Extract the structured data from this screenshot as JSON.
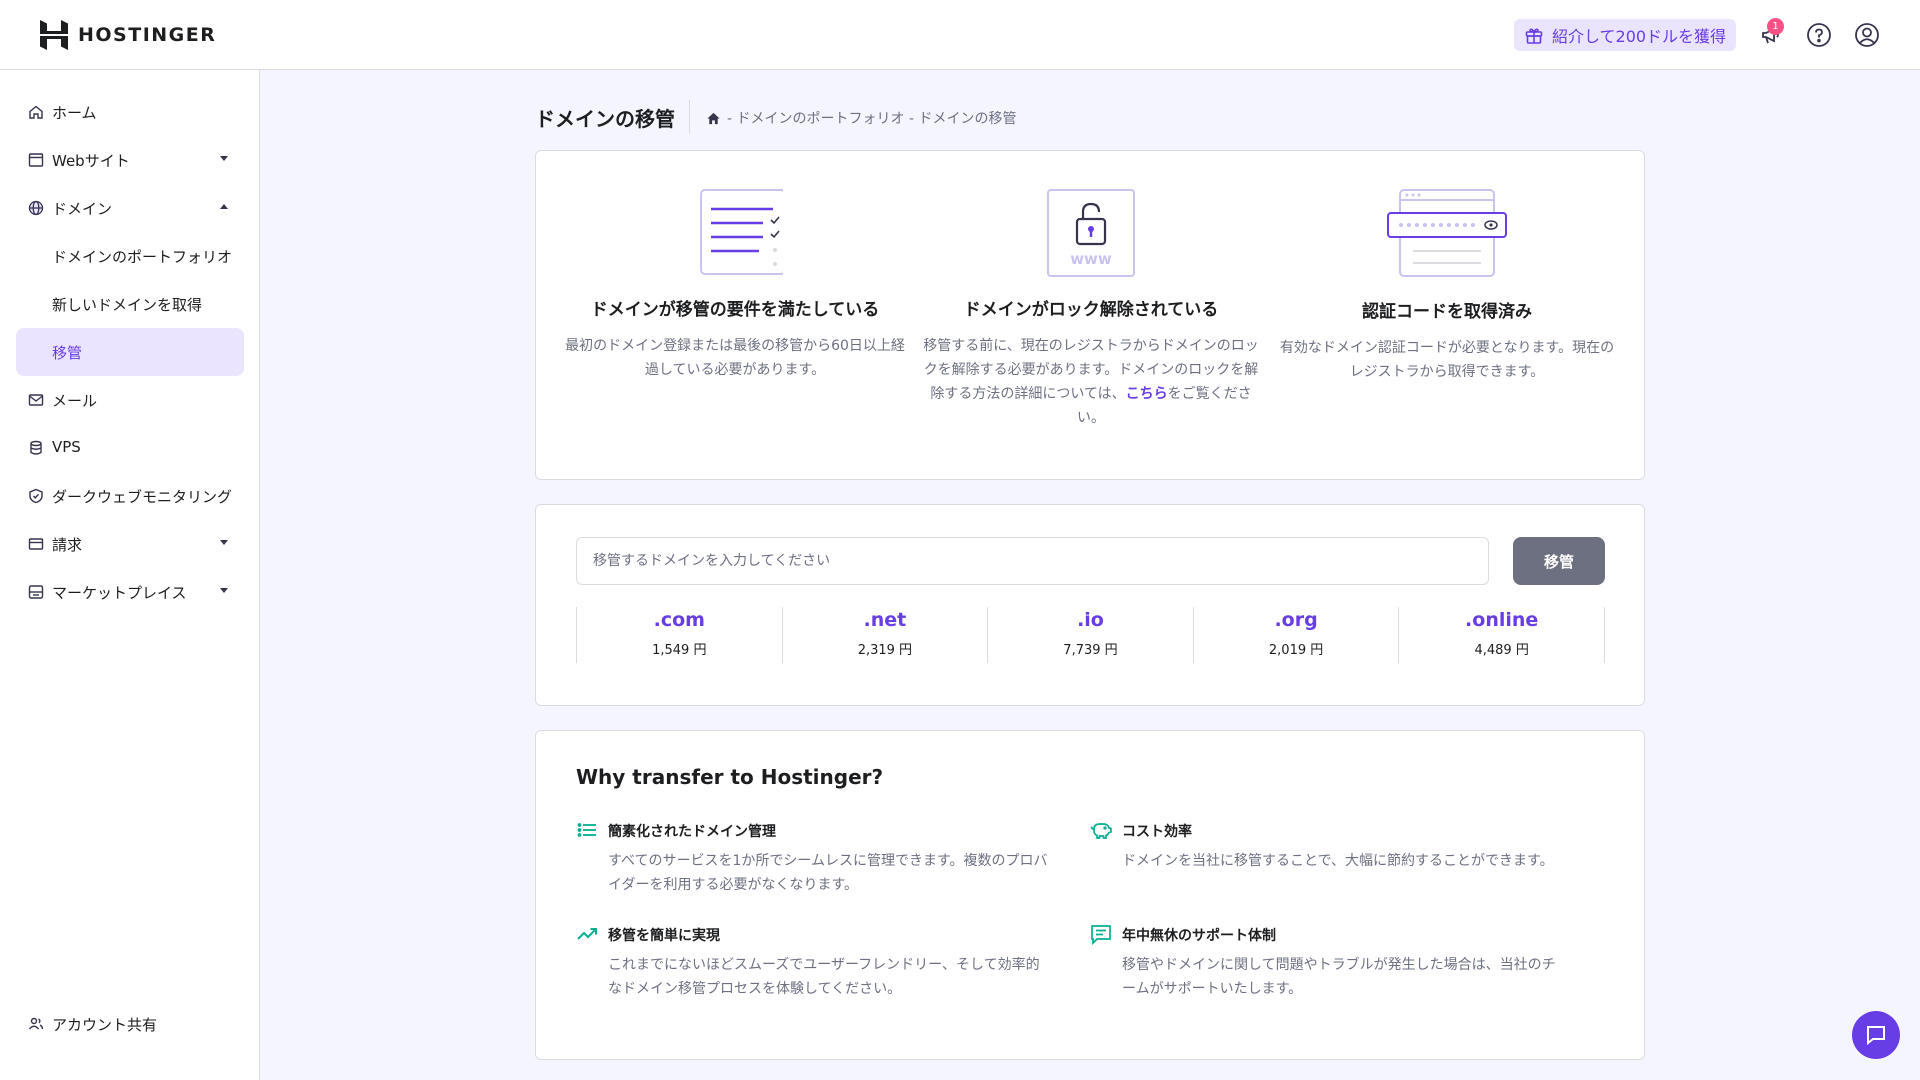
{
  "header": {
    "brand": "HOSTINGER",
    "referral": "紹介して200ドルを獲得",
    "notification_count": "1",
    "icons": [
      "gift-icon",
      "megaphone-icon",
      "help-icon",
      "account-icon"
    ]
  },
  "sidebar": {
    "items": [
      {
        "label": "ホーム",
        "icon": "home-icon"
      },
      {
        "label": "Webサイト",
        "icon": "browser-icon"
      },
      {
        "label": "ドメイン",
        "icon": "globe-icon"
      },
      {
        "label": "メール",
        "icon": "mail-icon"
      },
      {
        "label": "VPS",
        "icon": "server-icon"
      },
      {
        "label": "ダークウェブモニタリング",
        "icon": "shield-icon"
      },
      {
        "label": "請求",
        "icon": "card-icon"
      },
      {
        "label": "マーケットプレイス",
        "icon": "store-icon"
      }
    ],
    "sub_items": [
      "ドメインのポートフォリオ",
      "新しいドメインを取得",
      "移管"
    ],
    "footer": "アカウント共有"
  },
  "page": {
    "title": "ドメインの移管",
    "breadcrumb": "- ドメインのポートフォリオ - ドメインの移管"
  },
  "requirements": [
    {
      "title": "ドメインが移管の要件を満たしている",
      "desc": "最初のドメイン登録または最後の移管から60日以上経過している必要があります。"
    },
    {
      "title": "ドメインがロック解除されている",
      "desc_before": "移管する前に、現在のレジストラからドメインのロックを解除する必要があります。ドメインのロックを解除する方法の詳細については、",
      "link": "こちら",
      "desc_after": "をご覧ください。"
    },
    {
      "title": "認証コードを取得済み",
      "desc": "有効なドメイン認証コードが必要となります。現在のレジストラから取得できます。"
    }
  ],
  "transfer": {
    "placeholder": "移管するドメインを入力してください",
    "button": "移管"
  },
  "tlds": [
    {
      "name": ".com",
      "price": "1,549 円"
    },
    {
      "name": ".net",
      "price": "2,319 円"
    },
    {
      "name": ".io",
      "price": "7,739 円"
    },
    {
      "name": ".org",
      "price": "2,019 円"
    },
    {
      "name": ".online",
      "price": "4,489 円"
    }
  ],
  "why": {
    "title": "Why transfer to Hostinger?",
    "benefits": [
      {
        "title": "簡素化されたドメイン管理",
        "desc": "すべてのサービスを1か所でシームレスに管理できます。複数のプロバイダーを利用する必要がなくなります。",
        "icon": "list-icon"
      },
      {
        "title": "コスト効率",
        "desc": "ドメインを当社に移管することで、大幅に節約することができます。",
        "icon": "piggy-bank-icon"
      },
      {
        "title": "移管を簡単に実現",
        "desc": "これまでにないほどスムーズでユーザーフレンドリー、そして効率的なドメイン移管プロセスを体験してください。",
        "icon": "trending-up-icon"
      },
      {
        "title": "年中無休のサポート体制",
        "desc": "移管やドメインに関して問題やトラブルが発生した場合は、当社のチームがサポートいたします。",
        "icon": "chat-icon"
      }
    ]
  },
  "colors": {
    "accent": "#673de6",
    "accent_light": "#ebe4ff",
    "muted": "#6d7081",
    "button_gray": "#6d7081"
  }
}
